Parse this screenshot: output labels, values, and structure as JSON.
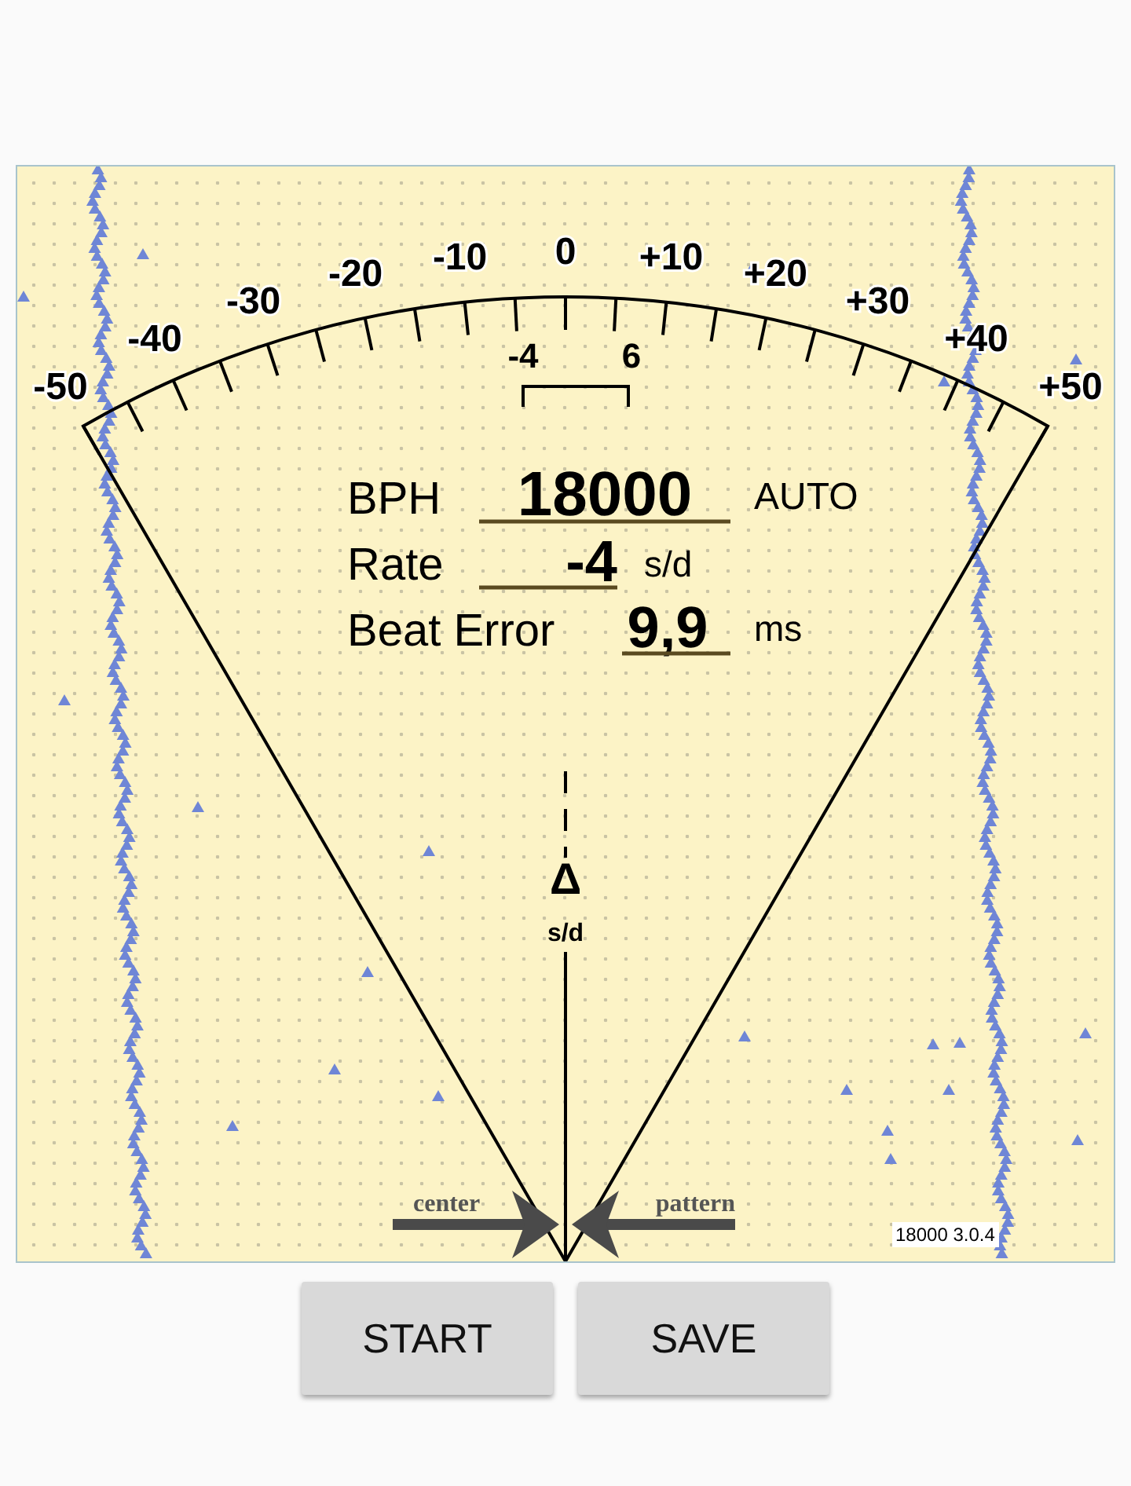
{
  "dial": {
    "scale_labels": [
      "-50",
      "-40",
      "-30",
      "-20",
      "-10",
      "0",
      "+10",
      "+20",
      "+30",
      "+40",
      "+50"
    ],
    "bracket_labels": [
      "-4",
      "6"
    ],
    "bph": {
      "label": "BPH",
      "value": "18000",
      "mode": "AUTO"
    },
    "rate": {
      "label": "Rate",
      "value": "-4",
      "unit": "s/d"
    },
    "beat_error": {
      "label": "Beat Error",
      "value": "9,9",
      "unit": "ms"
    },
    "delta": {
      "symbol": "Δ",
      "unit": "s/d"
    },
    "arrows": [
      "center",
      "pattern"
    ],
    "version": "18000 3.0.4"
  },
  "buttons": [
    "START",
    "SAVE"
  ]
}
